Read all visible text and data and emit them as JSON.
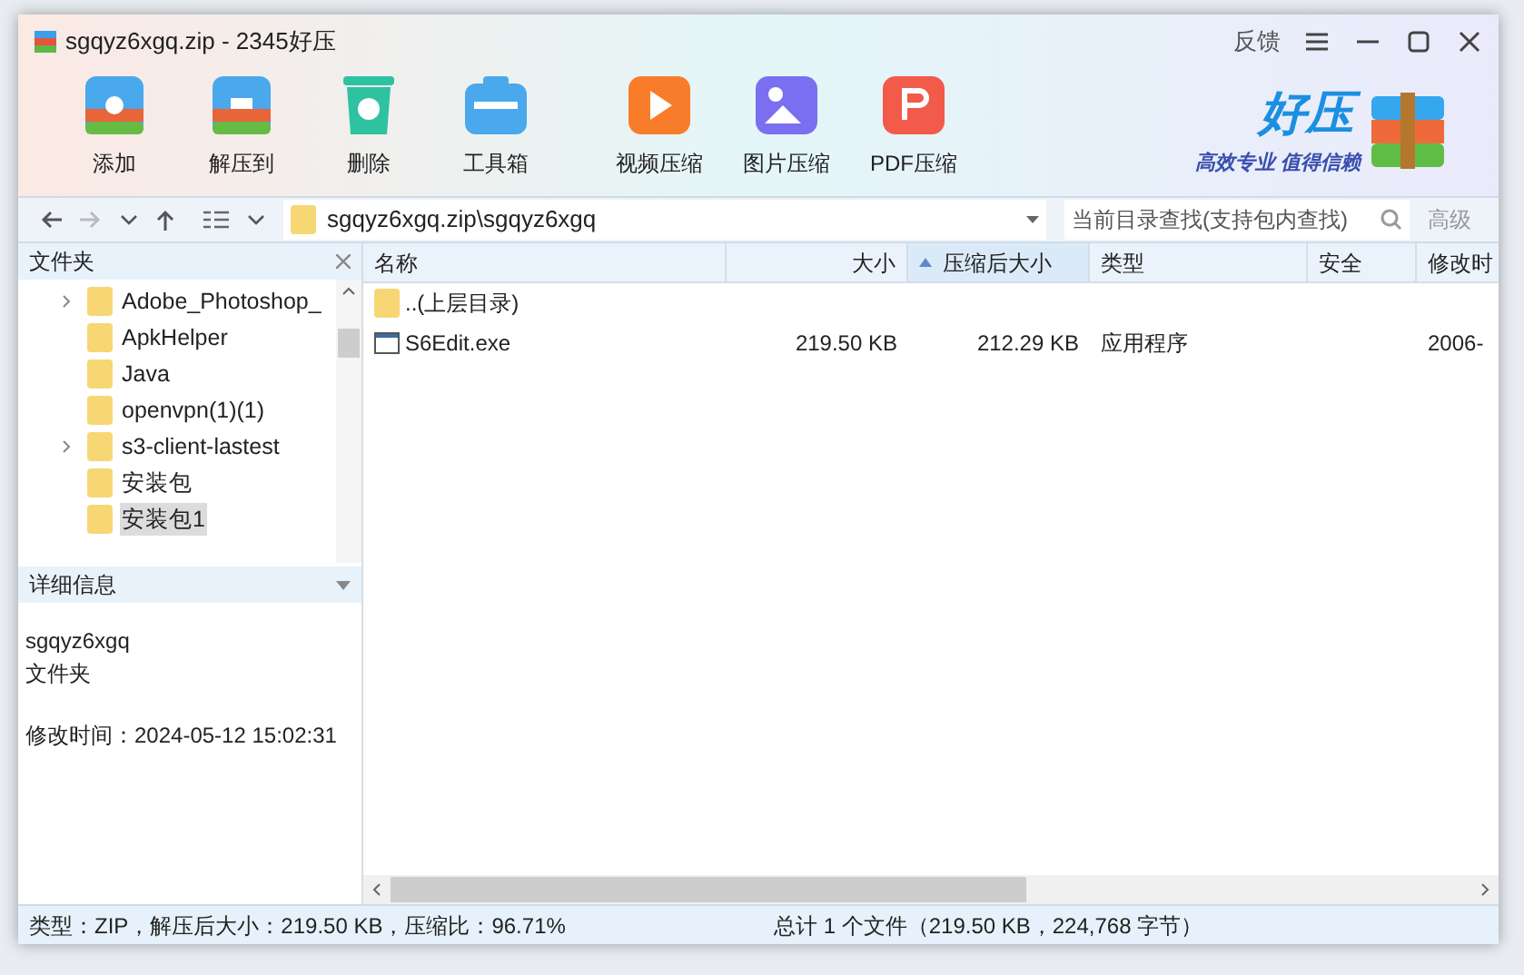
{
  "window": {
    "title": "sgqyz6xgq.zip - 2345好压",
    "feedback": "反馈"
  },
  "toolbar": [
    {
      "label": "添加",
      "kind": "add"
    },
    {
      "label": "解压到",
      "kind": "extract"
    },
    {
      "label": "删除",
      "kind": "delete"
    },
    {
      "label": "工具箱",
      "kind": "tools"
    },
    {
      "label": "视频压缩",
      "kind": "video"
    },
    {
      "label": "图片压缩",
      "kind": "image"
    },
    {
      "label": "PDF压缩",
      "kind": "pdf"
    }
  ],
  "logo": {
    "title": "好压",
    "slogan": "高效专业 值得信赖"
  },
  "address": {
    "path": "sgqyz6xgq.zip\\sgqyz6xgq"
  },
  "search": {
    "placeholder": "当前目录查找(支持包内查找)",
    "advanced": "高级"
  },
  "folders": {
    "title": "文件夹",
    "items": [
      {
        "name": "Adobe_Photoshop_",
        "expandable": true,
        "selected": false
      },
      {
        "name": "ApkHelper",
        "expandable": false,
        "selected": false
      },
      {
        "name": "Java",
        "expandable": false,
        "selected": false
      },
      {
        "name": "openvpn(1)(1)",
        "expandable": false,
        "selected": false
      },
      {
        "name": "s3-client-lastest",
        "expandable": true,
        "selected": false
      },
      {
        "name": "安装包",
        "expandable": false,
        "selected": false
      },
      {
        "name": "安装包1",
        "expandable": false,
        "selected": true
      }
    ]
  },
  "details": {
    "title": "详细信息",
    "name": "sgqyz6xgq",
    "type": "文件夹",
    "modified": "修改时间：2024-05-12 15:02:31"
  },
  "table": {
    "columns": [
      {
        "label": "名称",
        "sorted": false
      },
      {
        "label": "大小",
        "sorted": false
      },
      {
        "label": "压缩后大小",
        "sorted": true
      },
      {
        "label": "类型",
        "sorted": false
      },
      {
        "label": "安全",
        "sorted": false
      },
      {
        "label": "修改时",
        "sorted": false
      }
    ],
    "rows": [
      {
        "kind": "parent",
        "cells": [
          "..(上层目录)",
          "",
          "",
          "",
          "",
          ""
        ]
      },
      {
        "kind": "exe",
        "cells": [
          "S6Edit.exe",
          "219.50 KB",
          "212.29 KB",
          "应用程序",
          "",
          "2006-"
        ]
      }
    ]
  },
  "status_bar": {
    "left": "类型：ZIP，解压后大小：219.50 KB，压缩比：96.71%",
    "right": "总计 1 个文件（219.50 KB，224,768 字节）"
  }
}
